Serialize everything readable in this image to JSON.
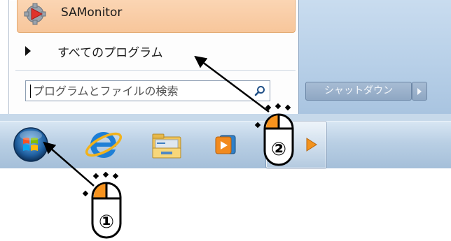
{
  "start_menu": {
    "pinned_item": {
      "label": "SAMonitor",
      "icon": "samonitor-app-icon"
    },
    "all_programs": {
      "label": "すべてのプログラム",
      "icon": "right-triangle-icon"
    },
    "search": {
      "placeholder": "プログラムとファイルの検索",
      "value": "",
      "icon": "magnifier-icon"
    },
    "shutdown": {
      "label": "シャットダウン",
      "arrow_icon": "right-arrow-icon"
    }
  },
  "taskbar": {
    "items": [
      {
        "name": "start-button",
        "icon": "windows-orb-icon"
      },
      {
        "name": "internet-explorer",
        "icon": "internet-explorer-icon"
      },
      {
        "name": "windows-explorer",
        "icon": "folder-icon"
      },
      {
        "name": "media-player",
        "icon": "media-player-icon"
      },
      {
        "name": "active-app",
        "icon": "app-icon"
      }
    ]
  },
  "annotations": {
    "step1": {
      "label": "①",
      "target": "start-button"
    },
    "step2": {
      "label": "②",
      "target": "all-programs"
    }
  },
  "colors": {
    "highlight": "#f7c69b",
    "right_pane": "#b8d0e8",
    "taskbar": "#b9cfe4",
    "mouse_accent": "#f7931e",
    "arrow": "#000000"
  }
}
